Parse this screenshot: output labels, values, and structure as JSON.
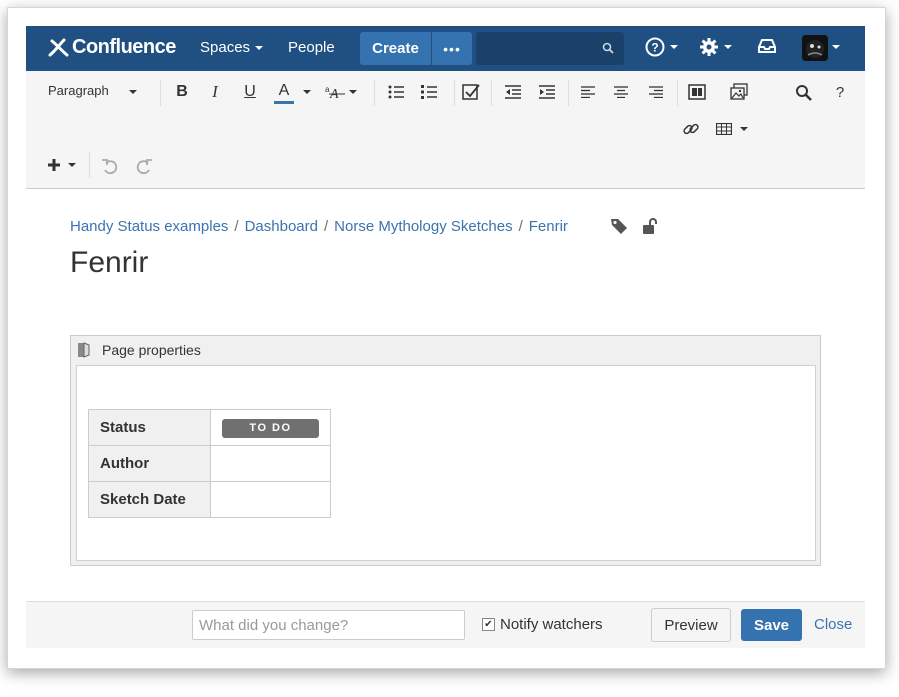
{
  "nav": {
    "logo": "Confluence",
    "spaces": "Spaces",
    "people": "People",
    "create": "Create",
    "more": "•••",
    "search_placeholder": ""
  },
  "toolbar": {
    "paragraph": "Paragraph",
    "bold": "B",
    "italic": "I",
    "underline": "U",
    "text_color": "A",
    "help": "?"
  },
  "breadcrumb": [
    "Handy Status examples",
    "Dashboard",
    "Norse Mythology Sketches",
    "Fenrir"
  ],
  "page": {
    "title": "Fenrir",
    "macro_title": "Page properties",
    "properties": [
      {
        "label": "Status",
        "value": "TO DO"
      },
      {
        "label": "Author",
        "value": ""
      },
      {
        "label": "Sketch Date",
        "value": ""
      }
    ]
  },
  "footer": {
    "change_placeholder": "What did you change?",
    "notify": "Notify watchers",
    "preview": "Preview",
    "save": "Save",
    "close": "Close"
  },
  "colors": {
    "nav_bg": "#205081",
    "button_blue": "#3572b0",
    "link": "#3b73af",
    "status_gray": "#707070"
  }
}
